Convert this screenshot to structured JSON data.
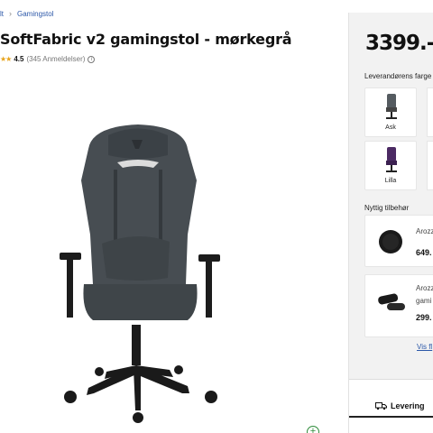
{
  "breadcrumb": {
    "prev": "lt",
    "current": "Gamingstol"
  },
  "product": {
    "title": "SoftFabric v2 gamingstol - mørkegrå",
    "rating": "4.5",
    "reviews": "(345 Anmeldelser)",
    "price": "3399.-"
  },
  "colors": {
    "label": "Leverandørens farge",
    "options": [
      {
        "name": "Ask",
        "color": "#4a4f55"
      },
      {
        "name": "Lilla",
        "color": "#4b2a63"
      }
    ]
  },
  "accessories": {
    "label": "Nyttig tilbehør",
    "items": [
      {
        "name": "Arozz",
        "price": "649."
      },
      {
        "name": "Arozz",
        "name2": "gami",
        "price": "299."
      }
    ],
    "more": "Vis fl"
  },
  "delivery": {
    "label": "Levering"
  }
}
